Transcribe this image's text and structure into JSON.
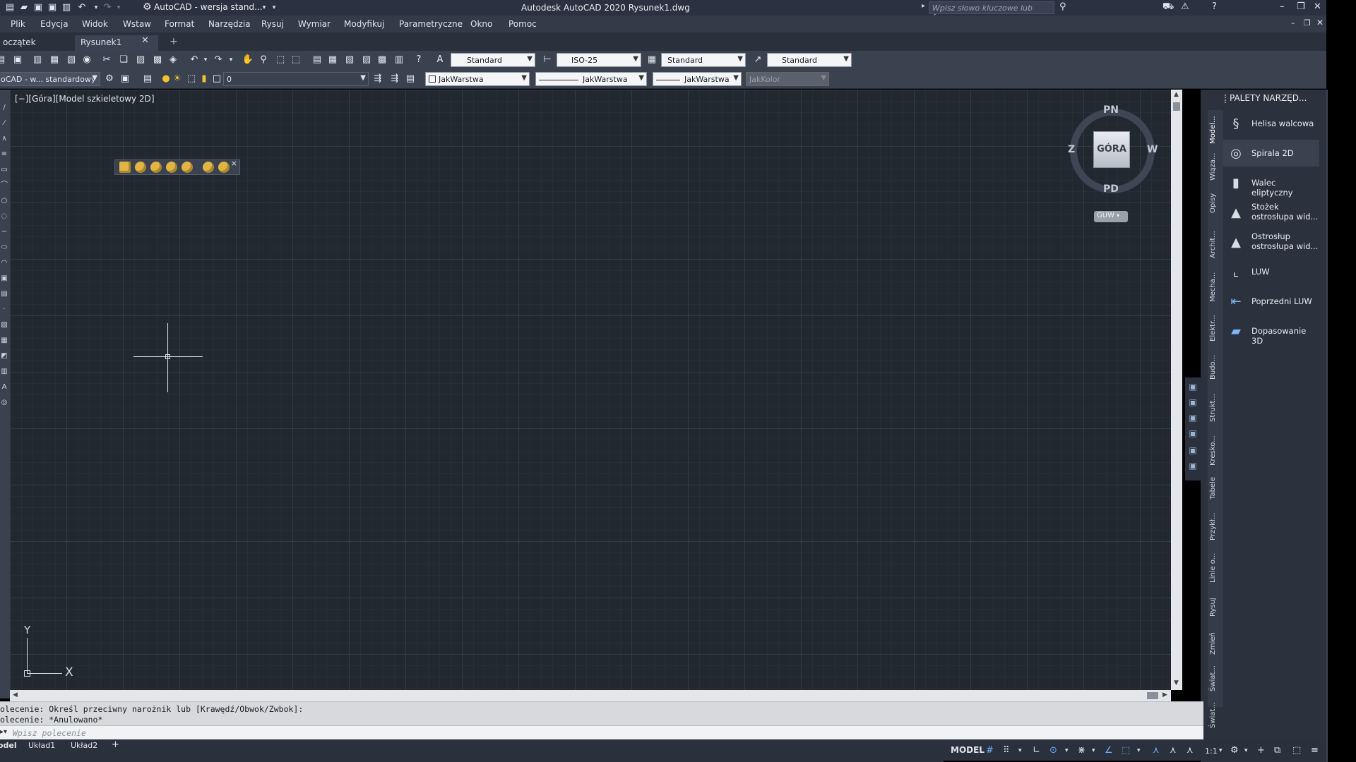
{
  "titlebar": {
    "workspace": "AutoCAD - wersja stand...",
    "title": "Autodesk AutoCAD 2020   Rysunek1.dwg",
    "search_placeholder": "Wpisz słowo kluczowe lub frazę"
  },
  "menu": [
    "Plik",
    "Edycja",
    "Widok",
    "Wstaw",
    "Format",
    "Narzędzia",
    "Rysuj",
    "Wymiar",
    "Modyfikuj",
    "Parametryczne",
    "Okno",
    "Pomoc"
  ],
  "tabs": {
    "start": "oczątek",
    "drawing": "Rysunek1"
  },
  "toolbar1": {
    "text_style": "Standard",
    "dim_style": "ISO-25",
    "table_style": "Standard",
    "mleader_style": "Standard"
  },
  "toolbar2": {
    "workspace": "oCAD - w... standardowy",
    "layer": "0",
    "color": "JakWarstwa",
    "linetype": "JakWarstwa",
    "lineweight": "JakWarstwa",
    "plotstyle": "JakKolor"
  },
  "viewport": {
    "label": "[−][Góra][Model szkieletowy 2D]"
  },
  "viewcube": {
    "face": "GÓRA",
    "north": "PN",
    "south": "PD",
    "west": "Z",
    "east": "W",
    "ucs": "GUW"
  },
  "ucs_icon": {
    "x": "X",
    "y": "Y"
  },
  "palette": {
    "title": "PALETY NARZĘD...",
    "tabs": [
      "Model...",
      "Wiąza...",
      "Opisy",
      "Archit...",
      "Mecha...",
      "Elektr...",
      "Budo...",
      "Strukt...",
      "Kresko...",
      "Tabele",
      "Przykł...",
      "Linie o...",
      "Rysuj",
      "Zmień",
      "Świat...",
      "Świat..."
    ],
    "items": [
      {
        "label": "Helisa walcowa",
        "icon": "helix-icon"
      },
      {
        "label": "Spirala 2D",
        "icon": "spiral-icon"
      },
      {
        "label": "Walec eliptyczny",
        "icon": "cylinder-icon"
      },
      {
        "label": "Stożek ostrosłupa wid...",
        "icon": "cone-icon"
      },
      {
        "label": "Ostrosłup ostrosłupa wid...",
        "icon": "pyramid-icon"
      },
      {
        "label": "LUW",
        "icon": "ucs-icon"
      },
      {
        "label": "Poprzedni LUW",
        "icon": "ucs-previous-icon"
      },
      {
        "label": "Dopasowanie 3D",
        "icon": "align-3d-icon"
      }
    ]
  },
  "command": {
    "history": [
      "olecenie: Określ przeciwny narożnik lub [Krawędź/Obwok/Zwbok]:",
      "olecenie: *Anulowano*"
    ],
    "input_placeholder": "Wpisz polecenie"
  },
  "layout_tabs": [
    "odel",
    "Układ1",
    "Układ2"
  ],
  "status": {
    "model": "MODEL",
    "scale": "1:1"
  },
  "colors": {
    "viewport_bg": "#212830",
    "ui_dark": "#3a4250",
    "accent": "#6fb2ff"
  }
}
